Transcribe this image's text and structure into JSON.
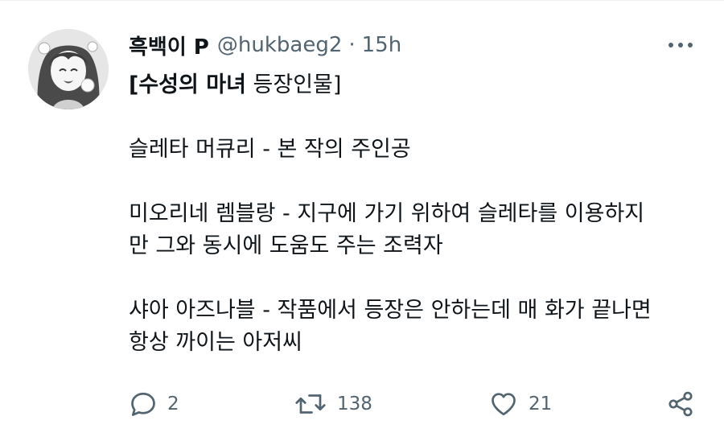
{
  "tweet": {
    "author": {
      "display_name": "흑백이 P",
      "handle": "@hukbaeg2",
      "separator": "·",
      "time": "15h"
    },
    "title_bold": "[수성의 마녀",
    "title_rest": " 등장인물]",
    "paragraphs": [
      "슬레타 머큐리 - 본 작의 주인공",
      "미오리네 렘블랑 - 지구에 가기 위하여 슬레타를 이용하지\n만 그와 동시에 도움도 주는 조력자",
      "샤아 아즈나블 - 작품에서 등장은 안하는데 매 화가 끝나면\n항상 까이는 아저씨"
    ],
    "metrics": {
      "replies": "2",
      "retweets": "138",
      "likes": "21"
    }
  },
  "icons": {
    "more": "more-horizontal-icon",
    "reply": "reply-icon",
    "retweet": "retweet-icon",
    "like": "heart-icon",
    "share": "share-icon"
  },
  "colors": {
    "text": "#0f1419",
    "secondary": "#536471",
    "divider": "#eff3f4"
  }
}
